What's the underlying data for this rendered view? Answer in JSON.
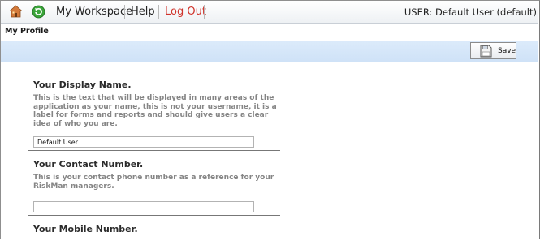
{
  "topbar": {
    "icons": [
      "home-icon",
      "refresh-icon"
    ],
    "my_workspace": "My Workspace",
    "help": "Help",
    "log_out": "Log Out",
    "user": "USER: Default User (default)"
  },
  "page": {
    "title": "My Profile"
  },
  "toolbar": {
    "save_label": "Save",
    "save_icon": "save-icon"
  },
  "sections": {
    "display_name": {
      "heading": "Your Display Name.",
      "description": "This is the text that will be displayed in many areas of the application as your name, this is not your username, it is a label for forms and reports and should give users a clear idea of who you are.",
      "value": "Default User"
    },
    "contact_number": {
      "heading": "Your Contact Number.",
      "description": "This is your contact phone number as a reference for your RiskMan managers.",
      "value": ""
    },
    "mobile_number": {
      "heading": "Your Mobile Number."
    }
  },
  "colors": {
    "toolbar_bg": "#d6e7fa",
    "logout": "#d0332b",
    "description": "#858585"
  }
}
